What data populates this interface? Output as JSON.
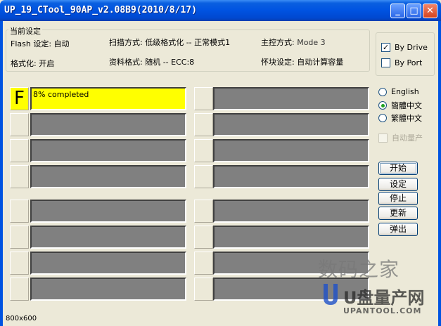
{
  "window": {
    "title": "UP_19_CTool_90AP_v2.08B9(2010/8/17)",
    "minimize": "_",
    "maximize": "□",
    "close": "✕"
  },
  "settings": {
    "group_title": "当前设定",
    "flash_label": "Flash 设定",
    "flash_value": ": 自动",
    "scan_label": "扫描方式",
    "scan_value": ": 低级格式化 -- 正常模式1",
    "controller_label": "主控方式",
    "controller_value": ": Mode 3",
    "format_label": "格式化",
    "format_value": ": 开启",
    "data_label": "资料格式",
    "data_value": ": 随机 -- ECC:8",
    "badblock_label": "怀块设定",
    "badblock_value": ": 自动计算容量"
  },
  "drive_opts": {
    "by_drive": "By Drive",
    "by_drive_checked": true,
    "by_port": "By Port",
    "by_port_checked": false
  },
  "language": {
    "options": [
      "English",
      "簡體中文",
      "繁體中文"
    ],
    "selected": "簡體中文"
  },
  "auto_production": {
    "label": "自动量产",
    "enabled": false
  },
  "buttons": {
    "start": "开始",
    "settings": "设定",
    "stop": "停止",
    "update": "更新",
    "eject": "弹出"
  },
  "slots": {
    "slot1_letter": "F",
    "slot1_status": "8% completed",
    "slot1_progress": 0.08
  },
  "status": {
    "resolution": "800x600"
  },
  "watermark": {
    "line1": "数码之家",
    "line2": "U盘量产网",
    "line3": "UPANTOOL.COM"
  },
  "colors": {
    "active_slot": "#FFFF00",
    "idle_slot": "#808080",
    "titlebar": "#0053E1"
  }
}
